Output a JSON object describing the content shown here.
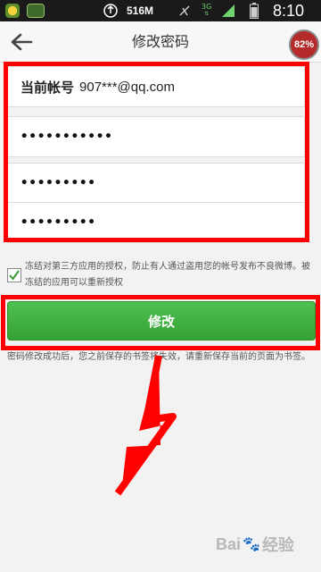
{
  "statusbar": {
    "memory": "516M",
    "network": "3G",
    "clock": "8:10"
  },
  "header": {
    "title": "修改密码",
    "battery_badge": "82%"
  },
  "form": {
    "account_label": "当前帐号",
    "account_value": "907***@qq.com",
    "old_password_masked": "•••••••••••",
    "new_password_masked": "•••••••••",
    "confirm_password_masked": "•••••••••"
  },
  "options": {
    "checkbox_checked": true,
    "note": "冻结对第三方应用的授权，防止有人通过盗用您的帐号发布不良微博。被冻结的应用可以重新授权"
  },
  "submit_label": "修改",
  "hint": "密码修改成功后，您之前保存的书签将失效，请重新保存当前的页面为书签。",
  "watermark": {
    "text_left": "Bai",
    "text_right": "经验"
  },
  "colors": {
    "highlight": "#ff0000",
    "primary_green": "#3cae3c"
  }
}
